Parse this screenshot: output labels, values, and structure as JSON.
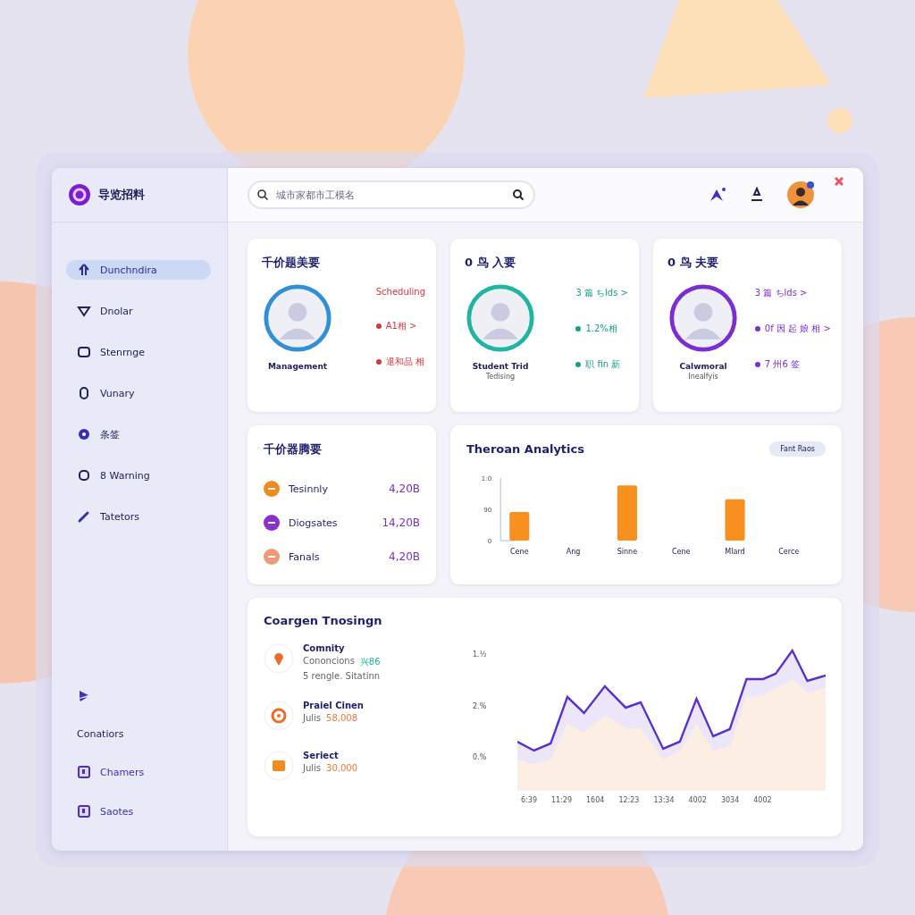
{
  "brand": {
    "name": "导览招料"
  },
  "sidebar": {
    "items": [
      {
        "label": "Dunchndira",
        "selected": true
      },
      {
        "label": "Dnolar",
        "selected": false
      },
      {
        "label": "Stenrnge",
        "selected": false
      },
      {
        "label": "Vunary",
        "selected": false
      },
      {
        "label": "条签",
        "selected": false
      },
      {
        "label": "8 Warning",
        "selected": false
      },
      {
        "label": "Tatetors",
        "selected": false
      }
    ],
    "footer": [
      {
        "kind": "icon"
      },
      {
        "kind": "text",
        "label": "Conatiors"
      },
      {
        "kind": "item",
        "label": "Chamers"
      },
      {
        "kind": "item",
        "label": "Saotes"
      }
    ]
  },
  "search": {
    "placeholder": "城市家都市工模名"
  },
  "profiles": [
    {
      "title": "千价题美要",
      "color": "#2f8fd8",
      "caption": "Management",
      "lines": [
        {
          "text": "Scheduling",
          "dot": false,
          "color": "#d9363e"
        },
        {
          "text": "A1相 >",
          "dot": true,
          "color": "#d9363e"
        },
        {
          "text": "退和品 相",
          "dot": true,
          "color": "#d9363e"
        }
      ]
    },
    {
      "title": "0 鸟 入要",
      "color": "#1fb5a0",
      "caption": "Student Trid",
      "subcaption": "Tedising",
      "lines": [
        {
          "text": "3 篇 ちlds >",
          "dot": false,
          "color": "#17a08c"
        },
        {
          "text": "1.2%相",
          "dot": true,
          "color": "#17a08c"
        },
        {
          "text": "职 fin 新",
          "dot": true,
          "color": "#17a08c"
        }
      ]
    },
    {
      "title": "0 鸟 夫要",
      "color": "#7b2fd0",
      "caption": "Calwmoral",
      "subcaption": "Inealfyis",
      "lines": [
        {
          "text": "3 篇 ちlds >",
          "dot": false,
          "color": "#7b2fd0"
        },
        {
          "text": "0f 因 起 娘 相 >",
          "dot": true,
          "color": "#7b2fd0"
        },
        {
          "text": "7 州6 签",
          "dot": true,
          "color": "#7b2fd0"
        }
      ]
    }
  ],
  "stats": {
    "title": "千价器腾要",
    "rows": [
      {
        "label": "Tesinnly",
        "value": "4,20B",
        "color": "#f08a1c"
      },
      {
        "label": "Diogsates",
        "value": "14,20B",
        "color": "#8a2fd0"
      },
      {
        "label": "Fanals",
        "value": "4,20B",
        "color": "#ee9a78"
      }
    ]
  },
  "analytics": {
    "title": "Theroan Analytics",
    "button": "Fant Raos",
    "chart_data": {
      "type": "bar",
      "categories": [
        "Cene",
        "Ang",
        "Sinne",
        "Cene",
        "Mlard",
        "Cerce"
      ],
      "series": [
        {
          "color": "#f7901e",
          "values": [
            82,
            null,
            159,
            null,
            119,
            null
          ]
        }
      ],
      "ylim": [
        0,
        180
      ],
      "yticks": [
        0,
        90,
        {
          "value": 180,
          "label": "1:0"
        }
      ]
    }
  },
  "training": {
    "title": "Coargen Tnosingn",
    "items": [
      {
        "title": "Comnity",
        "note": "Cononcions",
        "value": "兴86",
        "color": "#1fb5a0",
        "detail": "5 rengle. Sitatinn"
      },
      {
        "title": "Praiel Cinen",
        "note": "Julis",
        "value": "58,008",
        "color": "#f07a3a"
      },
      {
        "title": "Seriect",
        "note": "Julis",
        "value": "30,000",
        "color": "#f07a3a"
      }
    ],
    "yticks": [
      "1.½",
      "2.%",
      "0.%"
    ],
    "xlabels": [
      "6:39",
      "11:29",
      "1604",
      "12:23",
      "13:34",
      "4002",
      "3034",
      "4002"
    ]
  }
}
